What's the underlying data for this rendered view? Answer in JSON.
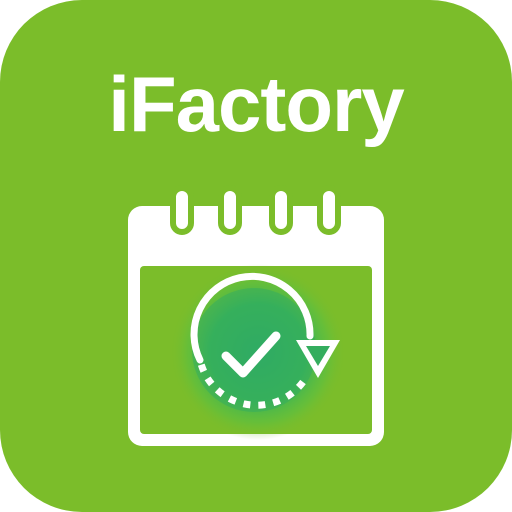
{
  "app": {
    "name": "iFactory"
  },
  "icons": {
    "calendar": "calendar-icon",
    "refresh_check": "refresh-check-icon"
  },
  "colors": {
    "background": "#7bbd2a",
    "foreground": "#ffffff",
    "glow": "#2fae5c"
  }
}
